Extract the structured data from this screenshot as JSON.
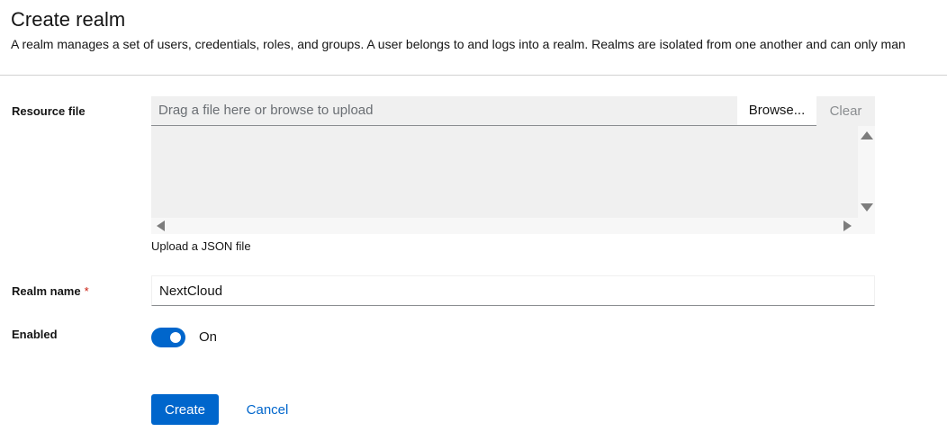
{
  "header": {
    "title": "Create realm",
    "description": "A realm manages a set of users, credentials, roles, and groups. A user belongs to and logs into a realm. Realms are isolated from one another and can only man"
  },
  "form": {
    "resource_file": {
      "label": "Resource file",
      "placeholder": "Drag a file here or browse to upload",
      "browse_label": "Browse...",
      "clear_label": "Clear",
      "helper_text": "Upload a JSON file"
    },
    "realm_name": {
      "label": "Realm name",
      "required_mark": "*",
      "value": "NextCloud"
    },
    "enabled": {
      "label": "Enabled",
      "state_label": "On",
      "checked": true
    }
  },
  "actions": {
    "create_label": "Create",
    "cancel_label": "Cancel"
  },
  "colors": {
    "primary": "#0066cc",
    "required": "#c9190b",
    "border": "#d2d2d2"
  },
  "icons": {
    "scroll_up": "triangle-up-icon",
    "scroll_down": "triangle-down-icon",
    "scroll_left": "triangle-left-icon",
    "scroll_right": "triangle-right-icon"
  }
}
